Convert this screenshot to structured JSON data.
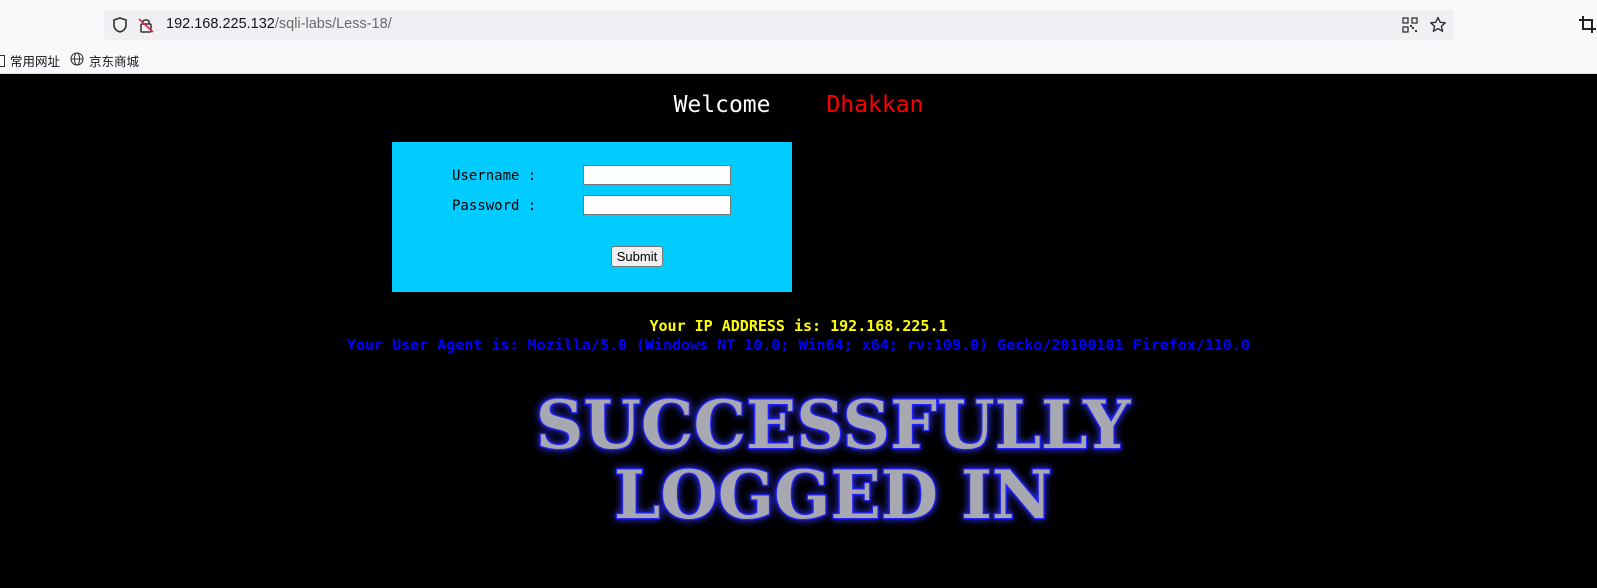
{
  "browser": {
    "url_host": "192.168.225.132",
    "url_path": "/sqli-labs/Less-18/",
    "bookmarks": [
      "常用网址",
      "京东商城"
    ]
  },
  "page": {
    "welcome": "Welcome",
    "name": "Dhakkan",
    "form": {
      "username_label": "Username :",
      "password_label": "Password :",
      "username_value": "",
      "password_value": "",
      "submit_label": "Submit"
    },
    "ip_line": "Your IP ADDRESS is: 192.168.225.1",
    "ua_line": "Your User Agent is: Mozilla/5.0 (Windows NT 10.0; Win64; x64; rv:109.0) Gecko/20100101 Firefox/110.0",
    "success_line1": "SUCCESSFULLY",
    "success_line2": "LOGGED IN"
  },
  "colors": {
    "form_bg": "#00ccff",
    "name": "#ff0000",
    "ip": "#ffff00",
    "ua": "#0000ff"
  }
}
